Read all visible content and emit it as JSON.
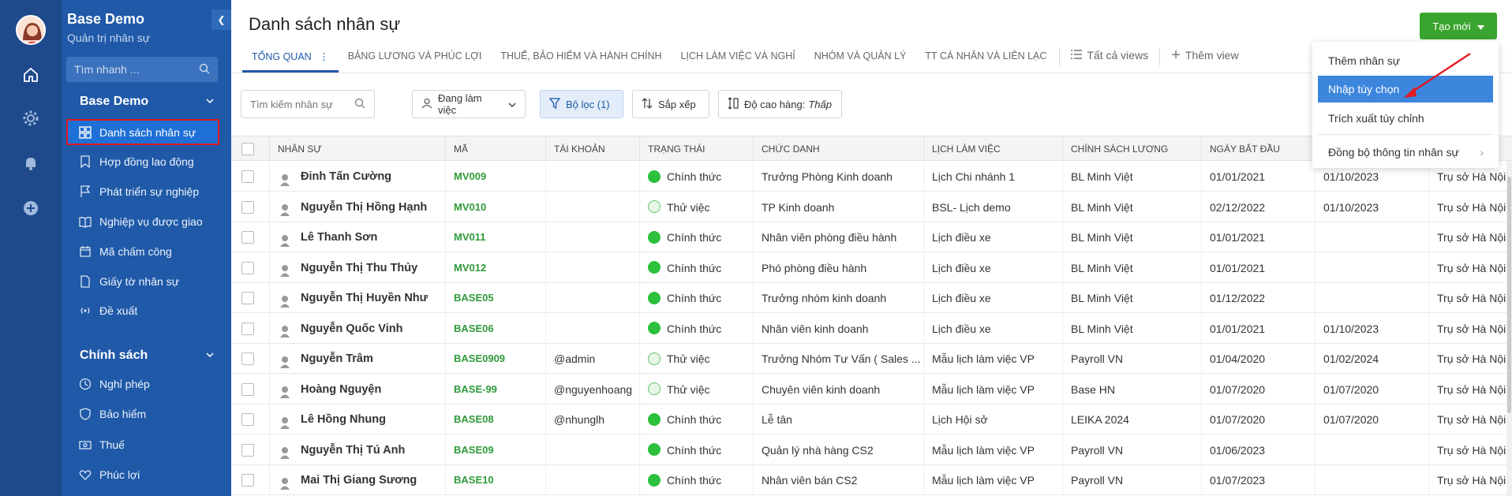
{
  "sidebar": {
    "title": "Base Demo",
    "subtitle": "Quản trị nhân sự",
    "search_placeholder": "Tìm nhanh ...",
    "section1": "Base Demo",
    "items1": [
      {
        "label": "Danh sách nhân sự",
        "icon": "grid-icon",
        "active": true
      },
      {
        "label": "Hợp đồng lao động",
        "icon": "bookmark-icon"
      },
      {
        "label": "Phát triển sự nghiệp",
        "icon": "flag-icon"
      },
      {
        "label": "Nghiệp vụ được giao",
        "icon": "book-icon"
      },
      {
        "label": "Mã chấm công",
        "icon": "calendar-icon"
      },
      {
        "label": "Giấy tờ nhân sự",
        "icon": "document-icon"
      },
      {
        "label": "Đề xuất",
        "icon": "broadcast-icon"
      }
    ],
    "section2": "Chính sách",
    "items2": [
      {
        "label": "Nghỉ phép",
        "icon": "clock-icon"
      },
      {
        "label": "Bảo hiểm",
        "icon": "shield-icon"
      },
      {
        "label": "Thuế",
        "icon": "money-icon"
      },
      {
        "label": "Phúc lợi",
        "icon": "heart-icon"
      }
    ]
  },
  "header": {
    "title": "Danh sách nhân sự",
    "new_button": "Tạo mới"
  },
  "tabs": [
    "Tổng quan",
    "Bảng lương và phúc lợi",
    "Thuế, bảo hiểm và hành chính",
    "Lịch làm việc và nghỉ",
    "Nhóm và quản lý",
    "TT cá nhân và liên lạc"
  ],
  "views": {
    "all": "Tất cả views",
    "add": "Thêm view"
  },
  "toolbar": {
    "search_placeholder": "Tìm kiếm nhân sự",
    "status": "Đang làm việc",
    "filter": "Bộ lọc (1)",
    "sort": "Sắp xếp",
    "row_height_label": "Độ cao hàng:",
    "row_height_value": "Thấp"
  },
  "dropdown": {
    "items": [
      "Thêm nhân sự",
      "Nhập tùy chọn",
      "Trích xuất tùy chỉnh",
      "Đồng bộ thông tin nhân sự"
    ],
    "highlighted": "Nhập tùy chọn"
  },
  "table": {
    "columns": [
      "Nhân sự",
      "Mã",
      "Tài khoản",
      "Trạng thái",
      "Chức danh",
      "Lịch làm việc",
      "Chính sách lương",
      "Ngày bắt đầu"
    ],
    "rows": [
      {
        "name": "Đinh Tấn Cường",
        "code": "MV009",
        "account": "",
        "status": "Chính thức",
        "title": "Trưởng Phòng Kinh doanh",
        "schedule": "Lịch Chi nhánh 1",
        "policy": "BL Minh Việt",
        "start": "01/01/2021",
        "extra": "01/10/2023",
        "office": "Trụ sở Hà Nội"
      },
      {
        "name": "Nguyễn Thị Hồng Hạnh",
        "code": "MV010",
        "account": "",
        "status": "Thử việc",
        "title": "TP Kinh doanh",
        "schedule": "BSL- Lịch demo",
        "policy": "BL Minh Việt",
        "start": "02/12/2022",
        "extra": "01/10/2023",
        "office": "Trụ sở Hà Nội"
      },
      {
        "name": "Lê Thanh Sơn",
        "code": "MV011",
        "account": "",
        "status": "Chính thức",
        "title": "Nhân viên phòng điều hành",
        "schedule": "Lịch điều xe",
        "policy": "BL Minh Việt",
        "start": "01/01/2021",
        "extra": "",
        "office": "Trụ sở Hà Nội"
      },
      {
        "name": "Nguyễn Thị Thu Thủy",
        "code": "MV012",
        "account": "",
        "status": "Chính thức",
        "title": "Phó phòng điều hành",
        "schedule": "Lịch điều xe",
        "policy": "BL Minh Việt",
        "start": "01/01/2021",
        "extra": "",
        "office": "Trụ sở Hà Nội"
      },
      {
        "name": "Nguyễn Thị Huyền Như",
        "code": "BASE05",
        "account": "",
        "status": "Chính thức",
        "title": "Trưởng nhóm kinh doanh",
        "schedule": "Lịch điều xe",
        "policy": "BL Minh Việt",
        "start": "01/12/2022",
        "extra": "",
        "office": "Trụ sở Hà Nội"
      },
      {
        "name": "Nguyễn Quốc Vinh",
        "code": "BASE06",
        "account": "",
        "status": "Chính thức",
        "title": "Nhân viên kinh doanh",
        "schedule": "Lịch điều xe",
        "policy": "BL Minh Việt",
        "start": "01/01/2021",
        "extra": "01/10/2023",
        "office": "Trụ sở Hà Nội"
      },
      {
        "name": "Nguyễn Trâm",
        "code": "BASE0909",
        "account": "@admin",
        "status": "Thử việc",
        "title": "Trưởng Nhóm Tư Vấn ( Sales ...",
        "schedule": "Mẫu lịch làm việc VP",
        "policy": "Payroll VN",
        "start": "01/04/2020",
        "extra": "01/02/2024",
        "office": "Trụ sở Hà Nội"
      },
      {
        "name": "Hoàng Nguyện",
        "code": "BASE-99",
        "account": "@nguyenhoang",
        "status": "Thử việc",
        "title": "Chuyên viên kinh doanh",
        "schedule": "Mẫu lịch làm việc VP",
        "policy": "Base HN",
        "start": "01/07/2020",
        "extra": "01/07/2020",
        "office": "Trụ sở Hà Nội"
      },
      {
        "name": "Lê Hồng Nhung",
        "code": "BASE08",
        "account": "@nhunglh",
        "status": "Chính thức",
        "title": "Lễ tân",
        "schedule": "Lịch Hội sở",
        "policy": "LEIKA 2024",
        "start": "01/07/2020",
        "extra": "01/07/2020",
        "office": "Trụ sở Hà Nội"
      },
      {
        "name": "Nguyễn Thị Tú Anh",
        "code": "BASE09",
        "account": "",
        "status": "Chính thức",
        "title": "Quản lý nhà hàng CS2",
        "schedule": "Mẫu lịch làm việc VP",
        "policy": "Payroll VN",
        "start": "01/06/2023",
        "extra": "",
        "office": "Trụ sở Hà Nội"
      },
      {
        "name": "Mai Thị Giang Sương",
        "code": "BASE10",
        "account": "",
        "status": "Chính thức",
        "title": "Nhân viên bán CS2",
        "schedule": "Mẫu lịch làm việc VP",
        "policy": "Payroll VN",
        "start": "01/07/2023",
        "extra": "",
        "office": "Trụ sở Hà Nội"
      }
    ]
  },
  "colors": {
    "rail": "#1e4a8c",
    "sidebar": "#1f59a8",
    "active": "#1e6fd6",
    "green": "#3aa52e",
    "highlight": "#3d86de",
    "arrow": "#e11b22"
  }
}
